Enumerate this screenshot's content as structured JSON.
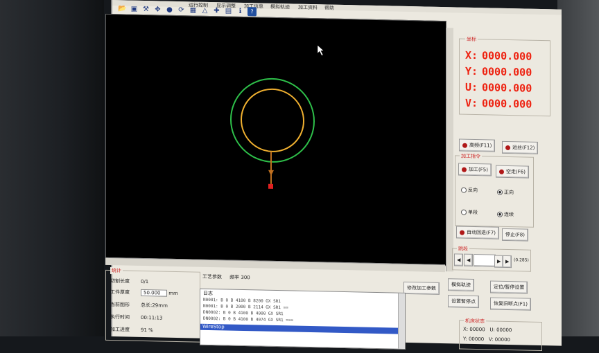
{
  "menu": [
    "运行控制",
    "显示调整",
    "加工信息",
    "模拟轨迹",
    "加工资料",
    "帮助"
  ],
  "toolbar_icons": [
    "open-folder-icon",
    "save-icon",
    "wrench-icon",
    "pan-icon",
    "marker-icon",
    "rotate-icon",
    "grid-icon",
    "layers-icon",
    "crosshair-icon",
    "zoom-icon",
    "info-icon",
    "help-icon"
  ],
  "coords": {
    "caption": "坐标",
    "rows": [
      {
        "label": "X:",
        "value": "0000.000"
      },
      {
        "label": "Y:",
        "value": "0000.000"
      },
      {
        "label": "U:",
        "value": "0000.000"
      },
      {
        "label": "V:",
        "value": "0000.000"
      }
    ]
  },
  "buttons": {
    "highfreq": "高频(F11)",
    "pump": "运丝(F12)",
    "process": "加工(F5)",
    "dry_run": "空走(F6)",
    "reverse_return": "自动回退(F7)",
    "stop": "停止(F8)",
    "sim_track": "模拟轨迹",
    "set_start": "设置暂停点",
    "locate_pause": "定位/暂停设置",
    "restore": "恢复旧断点(F1)",
    "param_btn": "修改加工参数"
  },
  "process_group": {
    "caption": "加工指令",
    "dir_a": "反向",
    "dir_b": "正向",
    "mode_a": "单段",
    "mode_b": "连续"
  },
  "jump": {
    "caption": "跳段",
    "value": "",
    "suffix": "(0.285)"
  },
  "stats": {
    "caption": "统计",
    "rows": [
      {
        "k": "切割长度",
        "v": "0/1"
      },
      {
        "k": "工件厚度",
        "v": "50.000",
        "unit": "mm"
      },
      {
        "k": "当前图形",
        "v": "总长:29mm"
      },
      {
        "k": "执行时间",
        "v": "00:11:13"
      },
      {
        "k": "加工进度",
        "v": "91 %"
      }
    ]
  },
  "params_line": {
    "label": "工艺参数",
    "speed_label": "频率",
    "speed": "300"
  },
  "log": {
    "title": "日志",
    "lines": [
      "N0001: B    0 B  4100 B  8200 GX SR1",
      "N0001: B    0 B  2000 B  2114 GX SR1 ==",
      "DN0002: B    0 B  4100 B  4000 GX SR1",
      "DN0002: B    0 B  4100 B  4074 GX SR1 ==="
    ],
    "selected": "WireStop"
  },
  "machine": {
    "caption": "机床状态",
    "x_label": "X:",
    "x_val": "00000",
    "u_label": "U:",
    "u_val": "00000",
    "y_label": "Y:",
    "y_val": "00000",
    "v_label": "V:",
    "v_val": "00000"
  },
  "colors": {
    "outer_ring": "#2ec04a",
    "inner_ring": "#f0b030",
    "lead_in": "#c07020",
    "start_point": "#e02020",
    "coord_text": "#e21"
  }
}
